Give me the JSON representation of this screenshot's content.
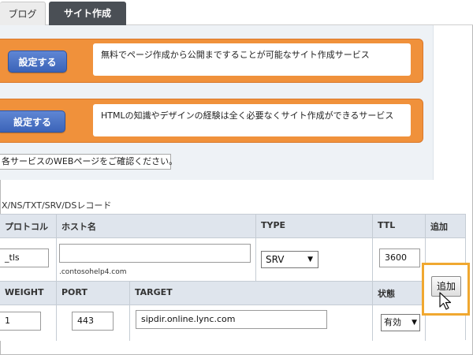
{
  "tabs": {
    "blog": "ブログ",
    "site_builder": "サイト作成"
  },
  "services": [
    {
      "button_label": "設定する",
      "description": "無料でページ作成から公開まですることが可能なサイト作成サービス"
    },
    {
      "button_label": "設定する",
      "description": "HTMLの知識やデザインの経験は全く必要なくサイト作成ができるサービス"
    }
  ],
  "notice": "各サービスのWEBページをご確認ください。",
  "record_types_label": "X/NS/TXT/SRV/DSレコード",
  "table": {
    "headers_row1": {
      "protocol": "プロトコル",
      "hostname": "ホスト名",
      "type": "TYPE",
      "ttl": "TTL",
      "add": "追加"
    },
    "headers_row2": {
      "weight": "WEIGHT",
      "port": "PORT",
      "target": "TARGET",
      "status": "状態"
    },
    "values": {
      "protocol": "_tls",
      "hostname": "",
      "domain_suffix": ".contosohelp4.com",
      "type": "SRV",
      "ttl": "3600",
      "weight": "1",
      "port": "443",
      "target": "sipdir.online.lync.com",
      "status": "有効"
    },
    "add_button_label": "追加"
  },
  "colors": {
    "accent_orange": "#f0913b",
    "button_blue": "#3c64b8",
    "highlight": "#f0a830",
    "header_bg": "#dfe5ed",
    "active_tab": "#4a4f55"
  }
}
